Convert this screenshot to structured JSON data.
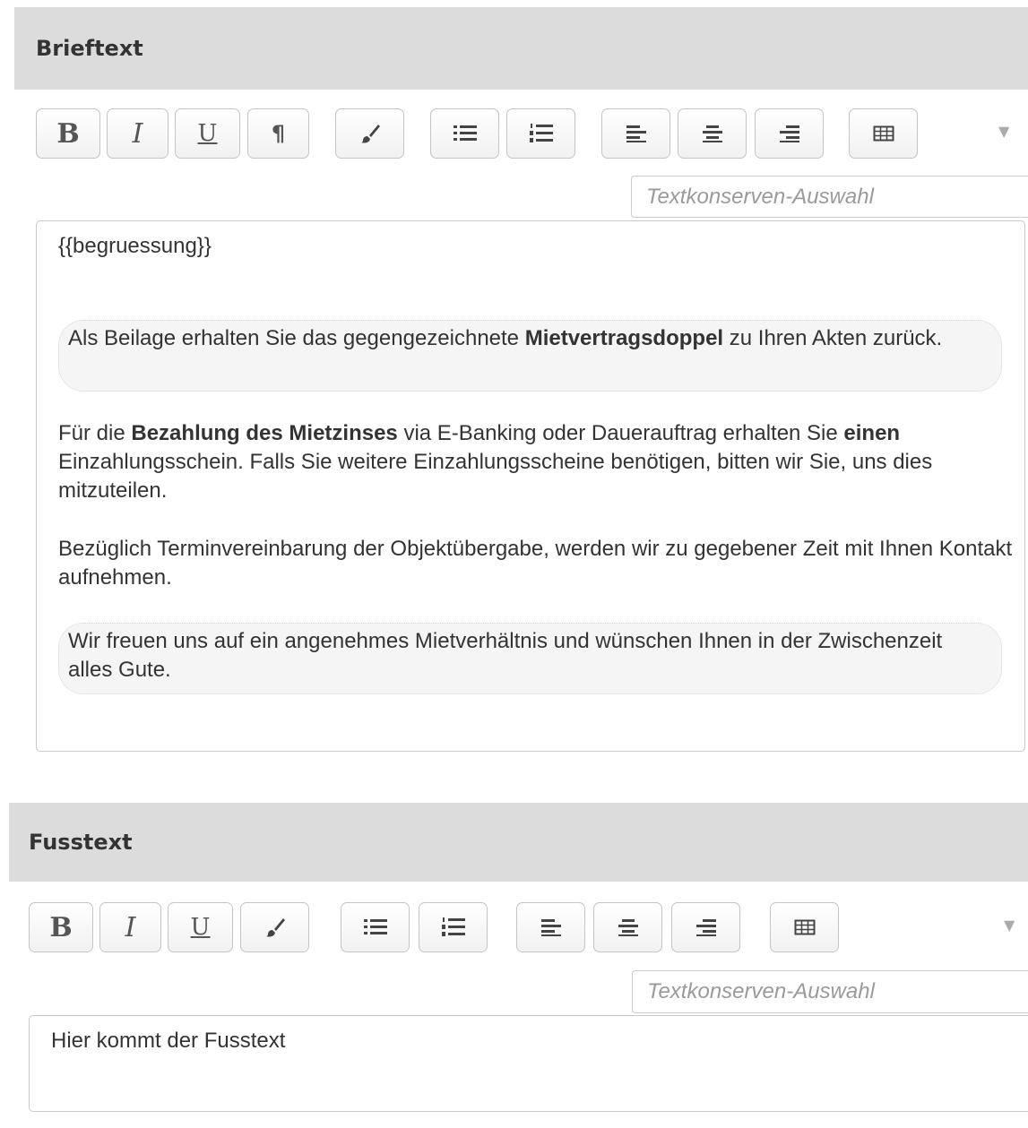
{
  "brief": {
    "title": "Brieftext",
    "toolbar": {
      "bold": "B",
      "italic": "I",
      "underline": "U",
      "paragraph": "¶"
    },
    "snippet_placeholder": "Textkonserven-Auswahl",
    "content": {
      "greeting": "{{begruessung}}",
      "p1": {
        "t1": "Als Beilage erhalten Sie das gegengezeichnete ",
        "b1": "Mietvertragsdoppel",
        "t2": " zu Ihren Akten zurück."
      },
      "p2": {
        "t1": "Für die ",
        "b1": "Bezahlung des Mietzinses",
        "t2": " via E-Banking oder Dauerauftrag erhalten Sie ",
        "b2": "einen",
        "t3": " Einzahlungsschein. Falls Sie weitere Einzahlungsscheine benötigen, bitten wir Sie, uns dies mitzuteilen."
      },
      "p3": "Bezüglich Terminvereinbarung der Objektübergabe, werden wir zu gegebener Zeit mit Ihnen Kontakt aufnehmen.",
      "p4": "Wir freuen uns auf ein angenehmes Mietverhältnis und wünschen Ihnen in der Zwischenzeit alles Gute."
    }
  },
  "fuss": {
    "title": "Fusstext",
    "toolbar": {
      "bold": "B",
      "italic": "I",
      "underline": "U"
    },
    "snippet_placeholder": "Textkonserven-Auswahl",
    "content": "Hier kommt der Fusstext"
  },
  "icons": [
    "bold-icon",
    "italic-icon",
    "underline-icon",
    "paragraph-icon",
    "brush-icon",
    "bullet-list-icon",
    "numbered-list-icon",
    "align-left-icon",
    "align-center-icon",
    "align-right-icon",
    "table-icon",
    "chevron-down-icon"
  ],
  "colors": {
    "header_bg": "#dcdcdc",
    "snippet_bg": "#f5f5f5",
    "placeholder": "#9a9a9a"
  }
}
